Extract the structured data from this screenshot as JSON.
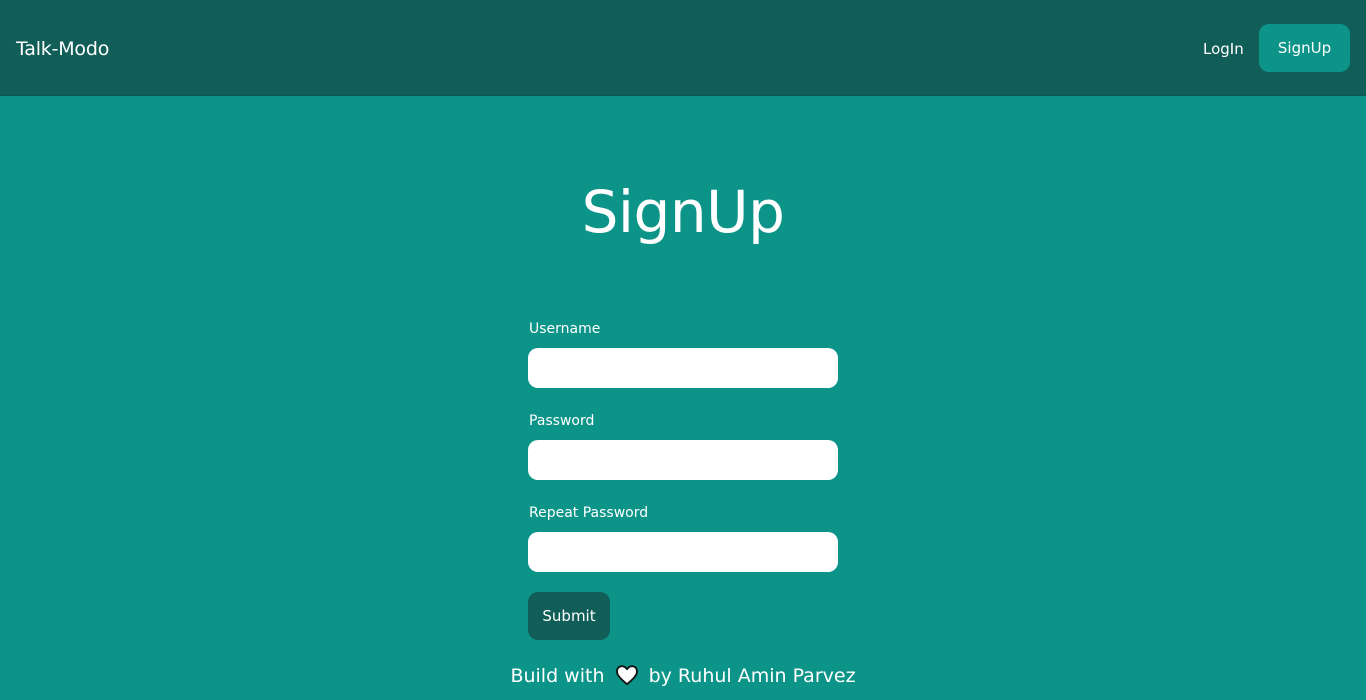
{
  "navbar": {
    "brand": "Talk-Modo",
    "login_label": "LogIn",
    "signup_label": "SignUp"
  },
  "page": {
    "title": "SignUp"
  },
  "form": {
    "username_label": "Username",
    "username_value": "",
    "password_label": "Password",
    "password_value": "",
    "repeat_password_label": "Repeat Password",
    "repeat_password_value": "",
    "submit_label": "Submit"
  },
  "footer": {
    "prefix": "Build with",
    "icon": "heart-icon",
    "suffix": "by Ruhul Amin Parvez"
  },
  "colors": {
    "background": "#0c9488",
    "navbar": "#115e59",
    "nav_signup_button": "#0d9488",
    "submit_button": "#115e59",
    "input": "#ffffff",
    "text": "#ffffff"
  }
}
